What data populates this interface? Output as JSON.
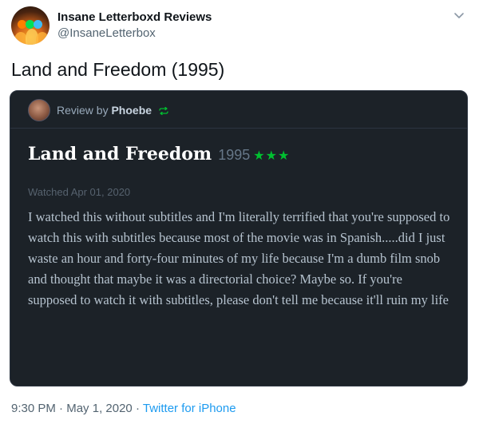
{
  "tweet": {
    "display_name": "Insane Letterboxd Reviews",
    "handle": "@InsaneLetterbox",
    "text": "Land and Freedom (1995)",
    "time": "9:30 PM",
    "date": "May 1, 2020",
    "separator": "·",
    "source": "Twitter for iPhone"
  },
  "review": {
    "review_by_label": "Review by ",
    "reviewer": "Phoebe",
    "film_title": "Land and Freedom",
    "year": "1995",
    "stars": "★★★",
    "rating_value": 3,
    "watched": "Watched Apr 01, 2020",
    "body": "I watched this without subtitles and I'm literally terrified that you're supposed to watch this with subtitles because most of the movie was in Spanish.....did I just waste an hour and forty-four minutes of my life because I'm a dumb film snob and thought that maybe it was a directorial choice? Maybe so. If you're supposed to watch it with subtitles, please don't tell me because it'll ruin my life"
  },
  "icons": {
    "chevron": "chevron-down-icon",
    "repeat": "repeat-icon"
  },
  "colors": {
    "card_bg": "#1c2228",
    "stars": "#00c030",
    "link": "#1d9bf0"
  }
}
